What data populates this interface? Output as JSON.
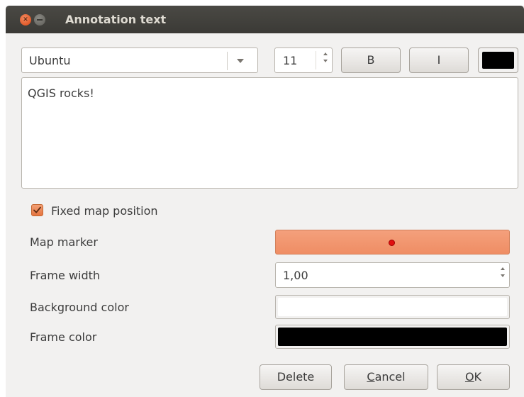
{
  "window": {
    "title": "Annotation text"
  },
  "toolbar": {
    "font_family": "Ubuntu",
    "font_size": "11",
    "bold_label": "B",
    "italic_label": "I",
    "text_color": "#000000"
  },
  "editor": {
    "text": "QGIS rocks!"
  },
  "options": {
    "fixed_map_position_label": "Fixed map position",
    "fixed_map_position_checked": true,
    "map_marker_label": "Map marker",
    "map_marker_color": "#e11010",
    "frame_width_label": "Frame width",
    "frame_width_value": "1,00",
    "background_color_label": "Background color",
    "background_color": "#ffffff",
    "frame_color_label": "Frame color",
    "frame_color": "#000000"
  },
  "buttons": {
    "delete_label": "Delete",
    "cancel_first": "C",
    "cancel_rest": "ancel",
    "ok_first": "O",
    "ok_rest": "K"
  }
}
